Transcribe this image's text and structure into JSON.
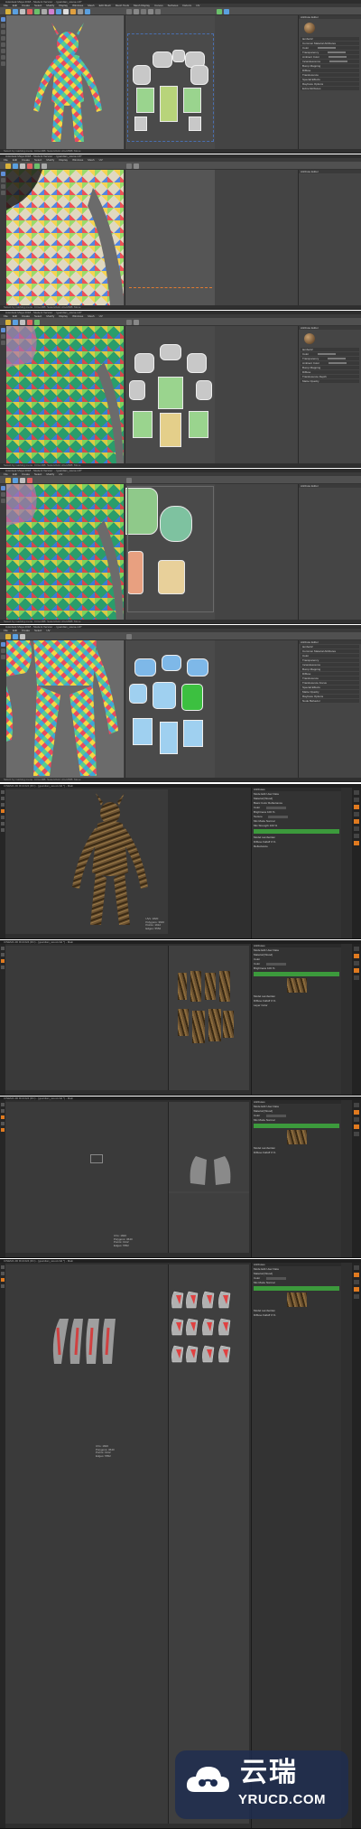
{
  "maya_panels": [
    {
      "title": "Autodesk Maya 2018 - Student Version: ...\\guardian_scene.mb*",
      "menu": [
        "File",
        "Edit",
        "Create",
        "Select",
        "Modify",
        "Display",
        "Windows",
        "Mesh",
        "Edit Mesh",
        "Mesh Tools",
        "Mesh Display",
        "Curves",
        "Surfaces",
        "Deform",
        "UV",
        "Generate",
        "Cache",
        "Arnold",
        "Help"
      ],
      "status": "Select by marking menu. Ctrl+LMB: Select/Add. Alt+MMB: Move"
    },
    {
      "title": "Autodesk Maya 2018 - Student Version: ...\\guardian_scene.mb*",
      "menu": [
        "File",
        "Edit",
        "Create",
        "Select",
        "Modify",
        "Display",
        "Windows",
        "Mesh",
        "Edit Mesh",
        "Mesh Tools",
        "Mesh Display",
        "Curves",
        "Surfaces",
        "Deform",
        "UV",
        "Generate",
        "Cache",
        "Arnold",
        "Help"
      ],
      "status": "Select by marking menu. Ctrl+LMB: Select/Add. Alt+MMB: Move"
    },
    {
      "title": "Autodesk Maya 2018 - Student Version: ...\\guardian_scene.mb*",
      "menu": [
        "File",
        "Edit",
        "Create",
        "Select",
        "Modify",
        "Display",
        "Windows",
        "Mesh",
        "Edit Mesh",
        "Mesh Tools",
        "Mesh Display",
        "Curves",
        "Surfaces",
        "Deform",
        "UV",
        "Generate",
        "Cache",
        "Arnold",
        "Help"
      ],
      "status": "Select by marking menu. Ctrl+LMB: Select/Add. Alt+MMB: Move"
    },
    {
      "title": "Autodesk Maya 2018 - Student Version: ...\\guardian_scene.mb*",
      "menu": [
        "File",
        "Edit",
        "Create",
        "Select",
        "Modify",
        "Display",
        "Windows",
        "Mesh",
        "Edit Mesh",
        "Mesh Tools",
        "Mesh Display",
        "Curves",
        "Surfaces",
        "Deform",
        "UV",
        "Generate",
        "Cache",
        "Arnold",
        "Help"
      ],
      "status": "Select by marking menu. Ctrl+LMB: Select/Add. Alt+MMB: Move"
    },
    {
      "title": "Autodesk Maya 2018 - Student Version: ...\\guardian_scene.mb*",
      "menu": [
        "File",
        "Edit",
        "Create",
        "Select",
        "Modify",
        "Display",
        "Windows",
        "Mesh",
        "Edit Mesh",
        "Mesh Tools",
        "Mesh Display",
        "Curves",
        "Surfaces",
        "Deform",
        "UV",
        "Generate",
        "Cache",
        "Arnold",
        "Help"
      ],
      "status": "Select by marking menu. Ctrl+LMB: Select/Add. Alt+MMB: Move"
    }
  ],
  "maya_attr": {
    "header": "Attribute Editor",
    "rows": [
      "lambert2",
      "Common Material Attributes",
      "Color",
      "Transparency",
      "Ambient Color",
      "Incandescence",
      "Bump Mapping",
      "Diffuse",
      "Translucence",
      "Translucence Depth",
      "Translucence Focus",
      "Special Effects",
      "Matte Opacity",
      "Raytrace Options",
      "Node Behavior",
      "Extra Attributes"
    ],
    "buttons": [
      "Select",
      "Load Attributes",
      "Copy Tab"
    ]
  },
  "c4d_panels": [
    {
      "title": "CINEMA 4D R19.024 (RC) - [guardian_wood.c4d *] - Main"
    },
    {
      "title": "CINEMA 4D R19.024 (RC) - [guardian_wood.c4d *] - Main"
    },
    {
      "title": "CINEMA 4D R19.024 (RC) - [guardian_wood.c4d *] - Main"
    },
    {
      "title": "CINEMA 4D R19.024 (RC) - [guardian_wood.c4d *] - Main"
    }
  ],
  "c4d_attr": {
    "header": "Attributes",
    "rows": [
      "Mode  Edit  User Data",
      "Material [Wood]",
      "Basic  Color  Reflectance",
      "Color",
      "Color  ",
      "Brightness  100 %",
      "Texture",
      "Mix Mode  Normal",
      "Mix Strength  100 %",
      "Model  Lambertian",
      "Diffuse Falloff  0 %",
      "Reflectance",
      "Layer Color"
    ],
    "texture_label": "Texture"
  },
  "c4d_readout": "UVs: 1820\nPolygons: 3640\nPoints: 1912\nEdges: 5552",
  "watermark": {
    "brand_cn": "云瑞",
    "url": "YRUCD.COM",
    "logo_icon": "cloud-icon"
  },
  "colors": {
    "maya_bg": "#444444",
    "c4d_bg": "#2f2f2f",
    "c4d_accent": "#e07a1f",
    "uv_green": "#9ad48e",
    "watermark_bg": "#1e2d50"
  }
}
